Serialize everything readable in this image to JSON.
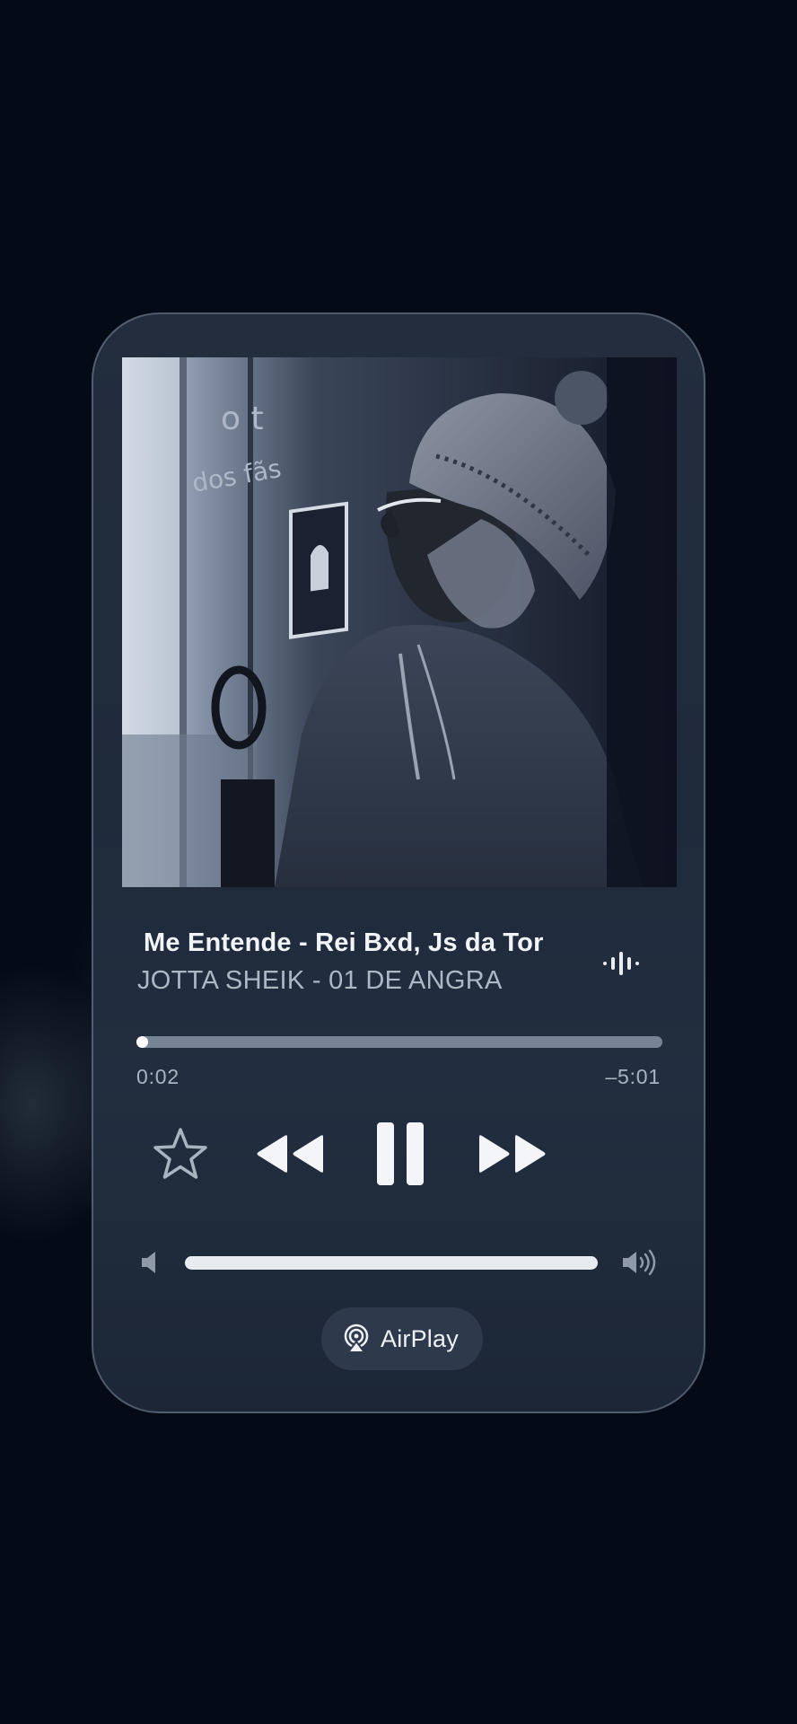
{
  "now_playing": {
    "title": "Me Entende - Rei Bxd, Js da Tor",
    "subtitle": "JOTTA SHEIK - 01 DE ANGRA",
    "elapsed": "0:02",
    "remaining": "–5:01",
    "progress_fraction": 0.006,
    "volume_fraction": 1.0
  },
  "artwork": {
    "sign_text_line1": "o t",
    "sign_text_line2": "dos fãs"
  },
  "controls": {
    "favorite_icon": "star-outline-icon",
    "rewind_icon": "rewind-icon",
    "pause_icon": "pause-icon",
    "forward_icon": "fast-forward-icon",
    "waveform_icon": "waveform-icon"
  },
  "volume": {
    "low_icon": "speaker-low-icon",
    "high_icon": "speaker-high-icon"
  },
  "airplay": {
    "label": "AirPlay",
    "icon": "airplay-icon"
  },
  "colors": {
    "background": "#050b16",
    "card": "#222d3e",
    "accent": "#ffffff"
  }
}
